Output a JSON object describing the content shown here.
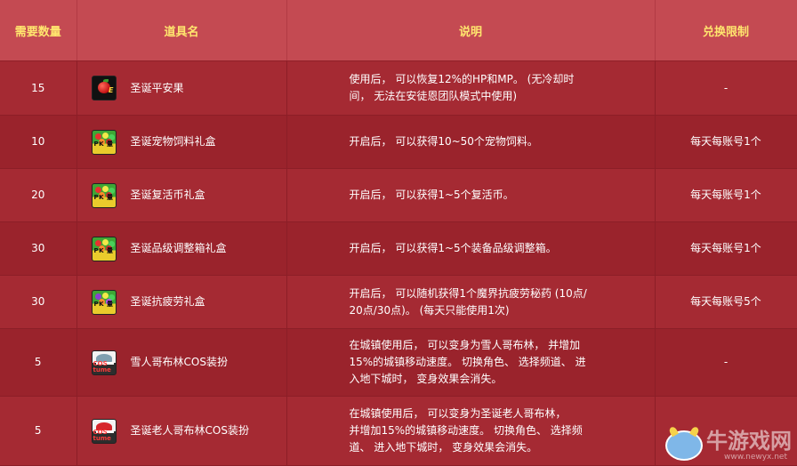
{
  "headers": {
    "qty": "需要数量",
    "name": "道具名",
    "desc": "说明",
    "limit": "兑换限制"
  },
  "rows": [
    {
      "qty": "15",
      "name": "圣诞平安果",
      "icon": "apple-icon",
      "desc_lines": [
        "使用后， 可以恢复12%的HP和MP。 (无冷却时",
        "间， 无法在安徒恩团队模式中使用)"
      ],
      "limit": "-"
    },
    {
      "qty": "10",
      "name": "圣诞宠物饲料礼盒",
      "icon": "gift-box-icon",
      "desc_lines": [
        "开启后， 可以获得10~50个宠物饲料。"
      ],
      "limit": "每天每账号1个"
    },
    {
      "qty": "20",
      "name": "圣诞复活币礼盒",
      "icon": "gift-box-icon",
      "desc_lines": [
        "开启后， 可以获得1~5个复活币。"
      ],
      "limit": "每天每账号1个"
    },
    {
      "qty": "30",
      "name": "圣诞品级调整箱礼盒",
      "icon": "gift-box-icon",
      "desc_lines": [
        "开启后， 可以获得1~5个装备品级调整箱。"
      ],
      "limit": "每天每账号1个"
    },
    {
      "qty": "30",
      "name": "圣诞抗疲劳礼盒",
      "icon": "gift-box-purple-icon",
      "desc_lines": [
        "开启后， 可以随机获得1个魔界抗疲劳秘药 (10点/",
        "20点/30点)。 (每天只能使用1次)"
      ],
      "limit": "每天每账号5个"
    },
    {
      "qty": "5",
      "name": "雪人哥布林COS装扮",
      "icon": "costume-icon",
      "desc_lines": [
        "在城镇使用后， 可以变身为雪人哥布林， 并增加",
        "15%的城镇移动速度。 切换角色、 选择频道、 进",
        "入地下城时， 变身效果会消失。"
      ],
      "limit": "-"
    },
    {
      "qty": "5",
      "name": "圣诞老人哥布林COS装扮",
      "icon": "costume-red-icon",
      "desc_lines": [
        "在城镇使用后， 可以变身为圣诞老人哥布林，",
        "并增加15%的城镇移动速度。 切换角色、 选择频",
        "道、 进入地下城时， 变身效果会消失。"
      ],
      "limit": ""
    }
  ],
  "icon_labels": {
    "apple": "E",
    "box": "PK 量",
    "costume": "COS tume"
  },
  "watermark": {
    "text": "牛游戏网",
    "url": "www.newyx.net"
  },
  "colors": {
    "header_bg": "#c44a52",
    "header_text": "#ffe66e",
    "row_bg_a": "#a52a33",
    "row_bg_b": "#9a232c"
  }
}
